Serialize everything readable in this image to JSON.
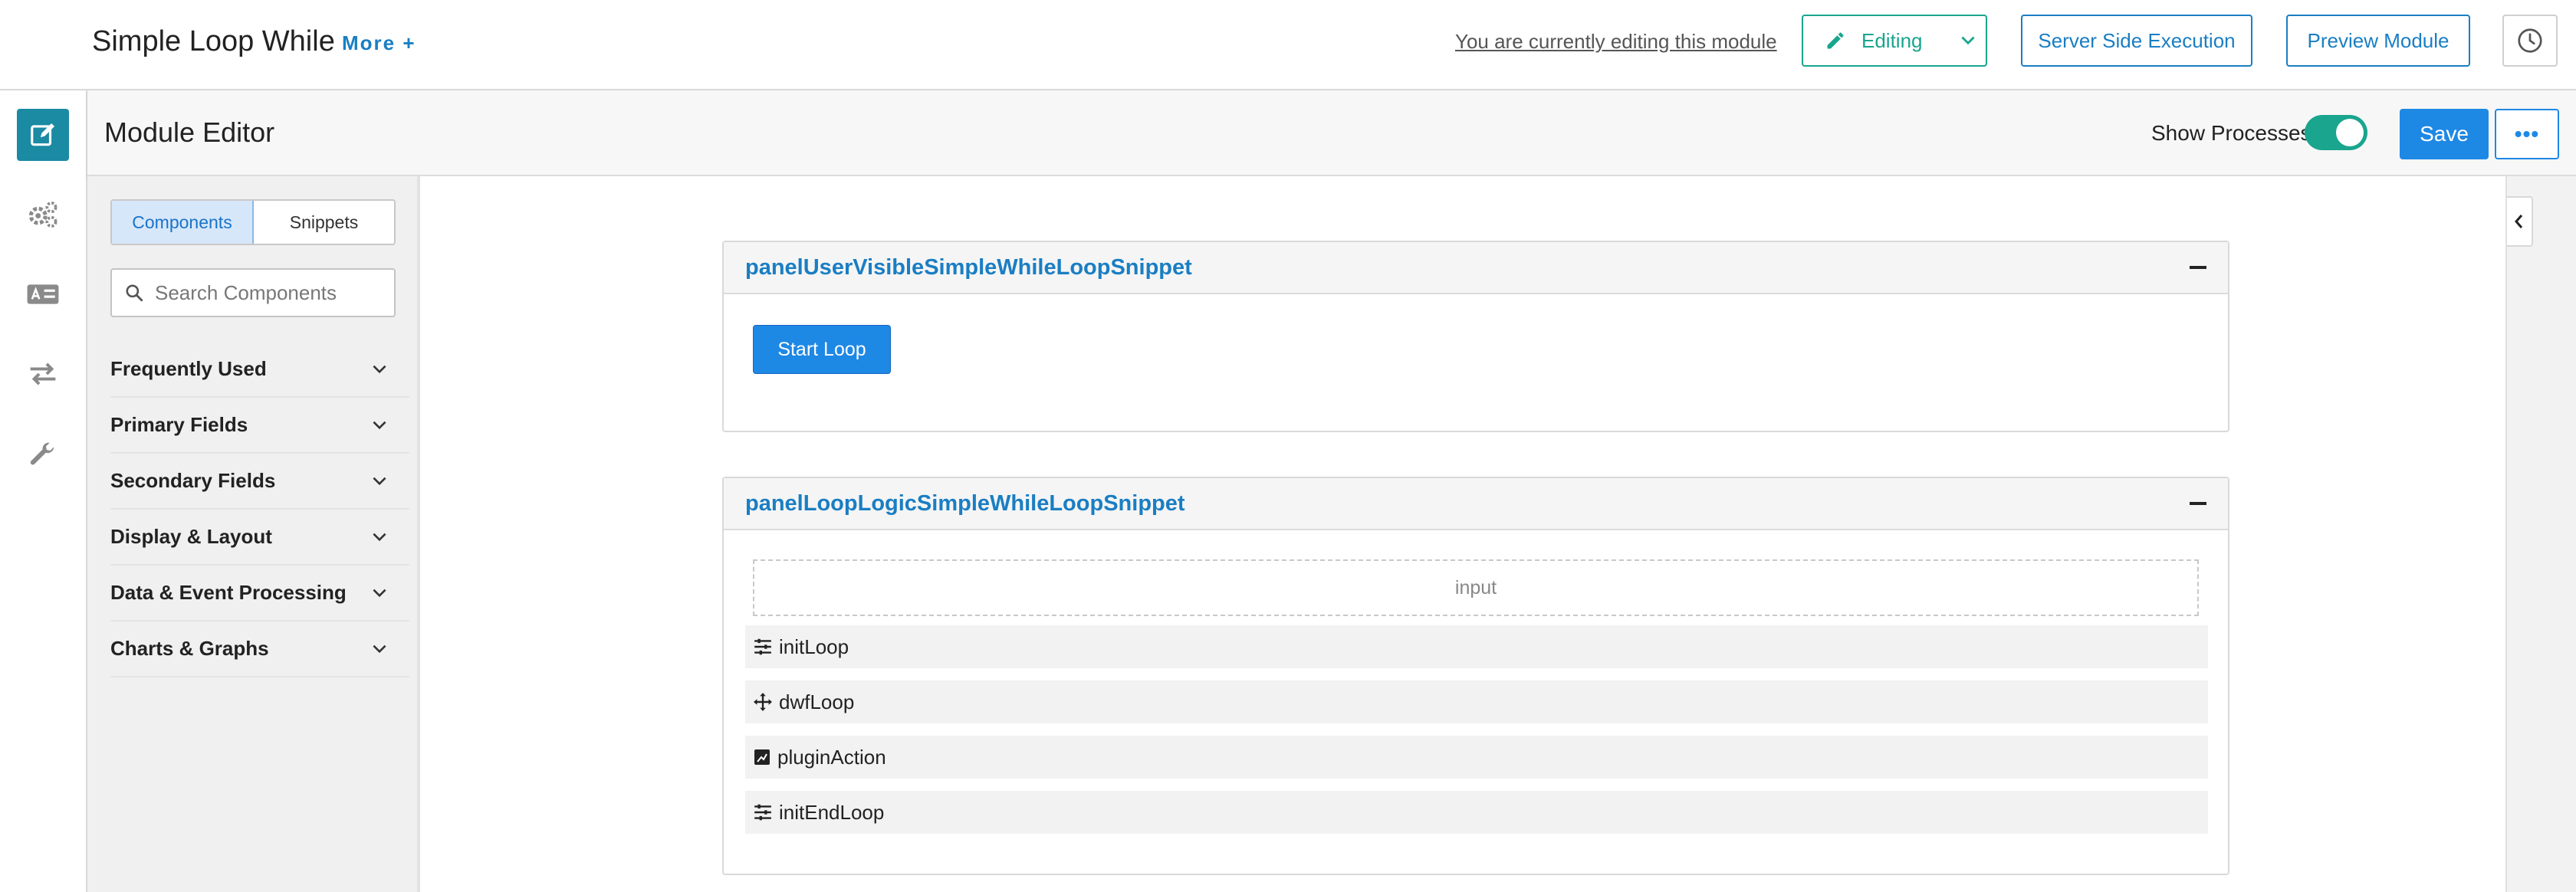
{
  "header": {
    "app_title": "Simple Loop While",
    "more_label": "More +",
    "editing_note": "You are currently editing this module",
    "editing_label": "Editing",
    "server_side_label": "Server Side Execution",
    "preview_label": "Preview Module"
  },
  "rail": {
    "items": [
      "edit-icon",
      "gears-icon",
      "id-card-icon",
      "arrows-swap-icon",
      "wrench-icon"
    ],
    "active": "edit-icon"
  },
  "editor_bar": {
    "title": "Module Editor",
    "show_processes_label": "Show Processes",
    "show_processes_on": true,
    "save_label": "Save",
    "more_label": "•••"
  },
  "sidebar": {
    "tabs": [
      {
        "label": "Components",
        "active": true
      },
      {
        "label": "Snippets",
        "active": false
      }
    ],
    "search_placeholder": "Search Components",
    "categories": [
      "Frequently Used",
      "Primary Fields",
      "Secondary Fields",
      "Display & Layout",
      "Data & Event Processing",
      "Charts & Graphs"
    ]
  },
  "canvas": {
    "panels": [
      {
        "title": "panelUserVisibleSimpleWhileLoopSnippet",
        "button_label": "Start Loop"
      },
      {
        "title": "panelLoopLogicSimpleWhileLoopSnippet",
        "input_placeholder": "input",
        "processes": [
          {
            "name": "initLoop",
            "icon": "sliders-icon"
          },
          {
            "name": "dwfLoop",
            "icon": "move-arrows-icon"
          },
          {
            "name": "pluginAction",
            "icon": "plugin-icon"
          },
          {
            "name": "initEndLoop",
            "icon": "sliders-icon"
          }
        ]
      }
    ]
  },
  "colors": {
    "accent": "#1e88e5",
    "link": "#1a7ec3",
    "teal": "#19a58e",
    "rail_active": "#1b8aa3"
  }
}
